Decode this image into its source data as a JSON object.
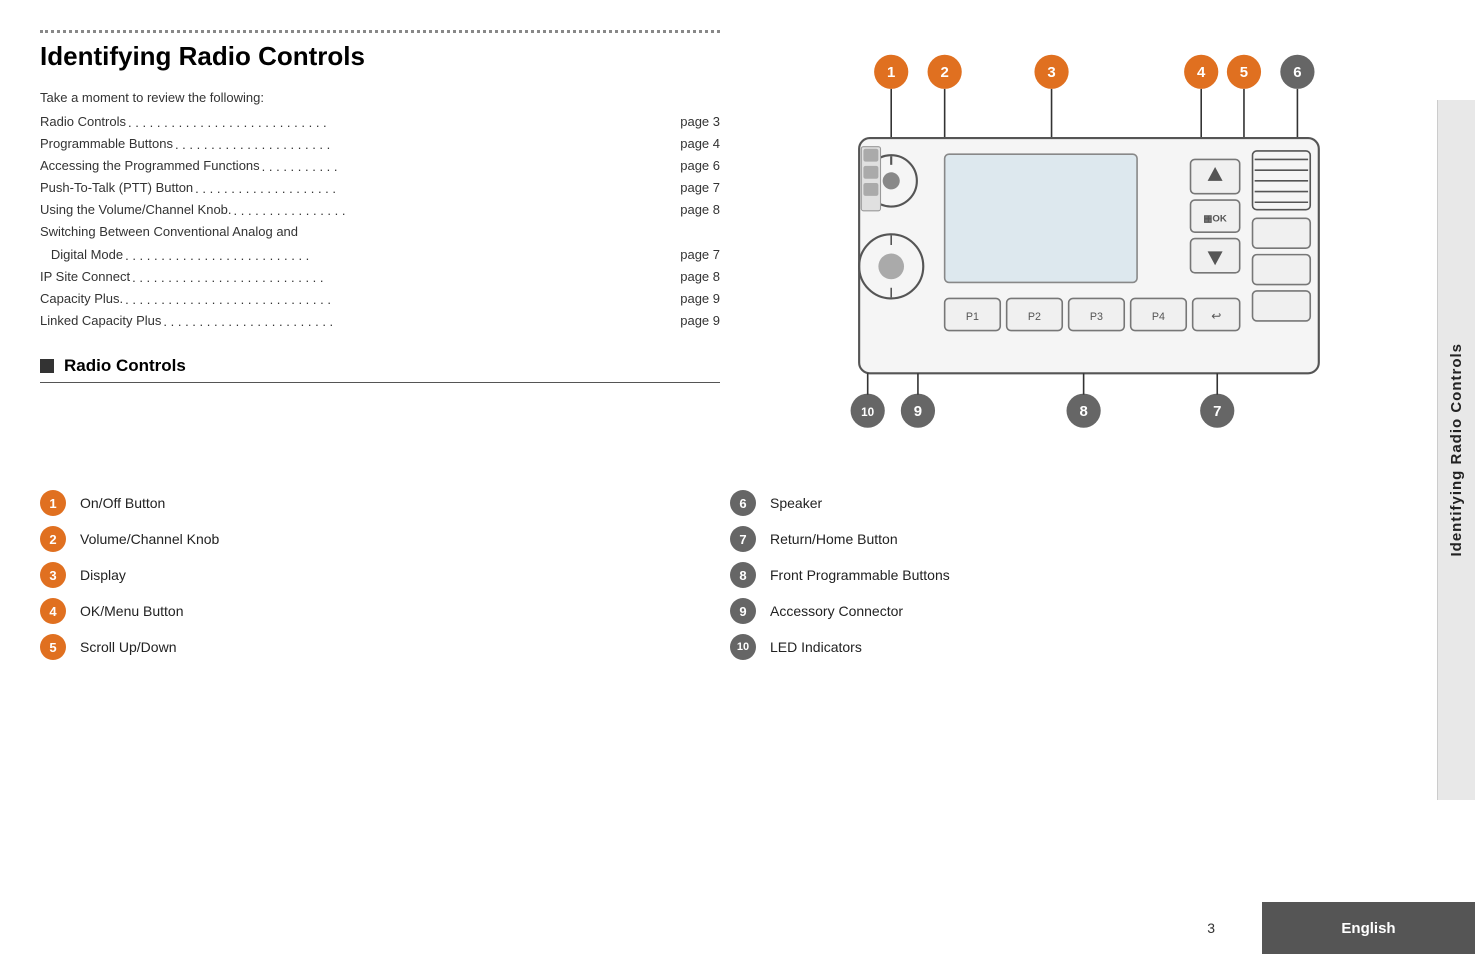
{
  "page": {
    "title": "Identifying Radio Controls",
    "sidebar_title": "Identifying Radio Controls",
    "page_number": "3",
    "language": "English"
  },
  "toc": {
    "intro": "Take a moment to review the following:",
    "items": [
      {
        "label": "Radio Controls",
        "dots": "...............................",
        "page": "page 3"
      },
      {
        "label": "Programmable Buttons",
        "dots": "...................",
        "page": "page 4"
      },
      {
        "label": "Accessing the Programmed Functions",
        "dots": "..........",
        "page": "page 6"
      },
      {
        "label": "Push-To-Talk (PTT) Button",
        "dots": "...................",
        "page": "page 7"
      },
      {
        "label": "Using the Volume/Channel Knob.",
        "dots": ".............",
        "page": "page 8"
      },
      {
        "label": "Switching Between Conventional Analog and",
        "dots": "",
        "page": ""
      },
      {
        "label": "   Digital Mode",
        "dots": ".........................",
        "page": "page 7"
      },
      {
        "label": "IP Site Connect",
        "dots": "...........................",
        "page": "page 8"
      },
      {
        "label": "Capacity Plus.",
        "dots": "..............................",
        "page": "page 9"
      },
      {
        "label": "Linked Capacity Plus",
        "dots": "........................",
        "page": "page 9"
      }
    ]
  },
  "section": {
    "title": "Radio Controls"
  },
  "controls_left": [
    {
      "num": "1",
      "label": "On/Off Button",
      "color": "orange"
    },
    {
      "num": "2",
      "label": "Volume/Channel Knob",
      "color": "orange"
    },
    {
      "num": "3",
      "label": "Display",
      "color": "orange"
    },
    {
      "num": "4",
      "label": "OK/Menu Button",
      "color": "orange"
    },
    {
      "num": "5",
      "label": "Scroll Up/Down",
      "color": "orange"
    }
  ],
  "controls_right": [
    {
      "num": "6",
      "label": "Speaker",
      "color": "gray"
    },
    {
      "num": "7",
      "label": "Return/Home Button",
      "color": "gray"
    },
    {
      "num": "8",
      "label": "Front Programmable Buttons",
      "color": "gray"
    },
    {
      "num": "9",
      "label": "Accessory Connector",
      "color": "gray"
    },
    {
      "num": "10",
      "label": "LED Indicators",
      "color": "gray"
    }
  ],
  "diagram": {
    "labels": [
      "1",
      "2",
      "3",
      "4",
      "5",
      "6",
      "7",
      "8",
      "9",
      "10"
    ]
  }
}
